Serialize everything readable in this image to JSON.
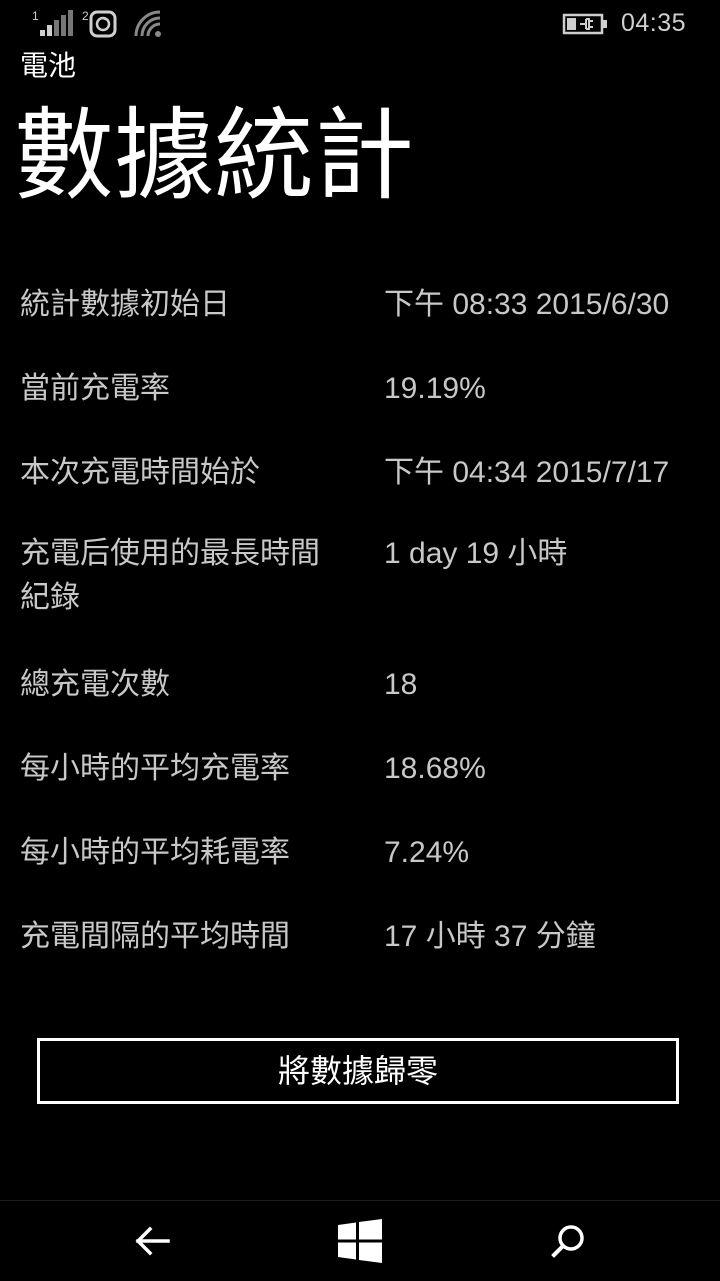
{
  "status_bar": {
    "sim1_label": "1",
    "sim2_label": "2",
    "time": "04:35",
    "icons": [
      "signal-sim1-icon",
      "sim2-sync-icon",
      "wifi-icon",
      "battery-charging-icon"
    ]
  },
  "app": {
    "title": "電池",
    "page_title": "數據統計"
  },
  "stats": [
    {
      "label": "統計數據初始日",
      "value": "下午 08:33 2015/6/30"
    },
    {
      "label": "當前充電率",
      "value": "19.19%"
    },
    {
      "label": "本次充電時間始於",
      "value": "下午 04:34 2015/7/17"
    },
    {
      "label": "充電后使用的最長時間紀錄",
      "value": "1 day 19 小時"
    },
    {
      "label": "總充電次數",
      "value": "18"
    },
    {
      "label": "每小時的平均充電率",
      "value": "18.68%"
    },
    {
      "label": "每小時的平均耗電率",
      "value": "7.24%"
    },
    {
      "label": "充電間隔的平均時間",
      "value": "17 小時 37 分鐘"
    }
  ],
  "actions": {
    "reset_label": "將數據歸零"
  },
  "nav_bar": {
    "icons": [
      "back-arrow-icon",
      "windows-start-icon",
      "search-icon"
    ]
  },
  "colors": {
    "background": "#000000",
    "text_primary": "#ffffff",
    "text_secondary": "#c8c8c8"
  }
}
